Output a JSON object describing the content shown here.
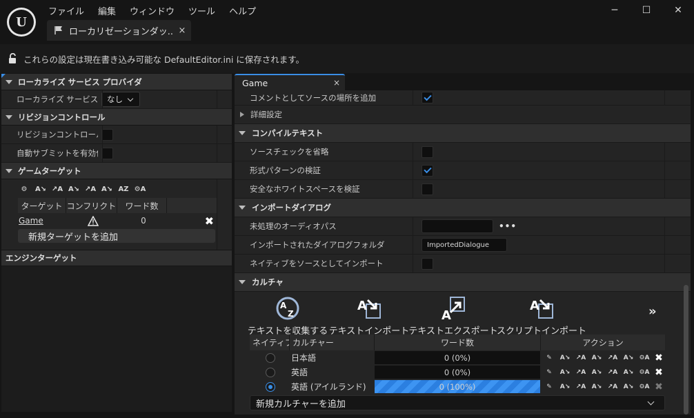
{
  "menu": [
    "ファイル",
    "編集",
    "ウィンドウ",
    "ツール",
    "ヘルプ"
  ],
  "window_controls": {
    "minimize": "─",
    "maximize": "☐",
    "close": "✕"
  },
  "doc_tab": {
    "label": "ローカリゼーションダッ...",
    "close": "×"
  },
  "notice": {
    "text": "これらの設定は現在書き込み可能な DefaultEditor.ini に保存されます。"
  },
  "left": {
    "cat_provider": "ローカライズ サービス プロバイダ",
    "provider_label": "ローカライズ サービス",
    "provider_value": "なし",
    "cat_revision": "リビジョンコントロール",
    "revision_label": "リビジョンコントロール:",
    "autosubmit_label": "自動サブミットを有効化",
    "cat_game_targets": "ゲームターゲット",
    "gt_headers": [
      "ターゲット",
      "コンフリクト",
      "ワード数"
    ],
    "gt_row": {
      "name": "Game",
      "words": "0",
      "delete": "✖"
    },
    "add_target": "新規ターゲットを追加",
    "cat_engine_targets": "エンジンターゲット"
  },
  "right": {
    "tab_label": "Game",
    "tab_close": "×",
    "comment_source": "コメントとしてソースの場所を追加",
    "advanced": "詳細設定",
    "cat_compile": "コンパイルテキスト",
    "skip_source_check": "ソースチェックを省略",
    "validate_format": "形式パターンの検証",
    "validate_whitespace": "安全なホワイトスペースを検証",
    "cat_import_dialogue": "インポートダイアログ",
    "raw_audio_path": "未処理のオーディオパス",
    "raw_audio_dots": "•••",
    "imported_folder_label": "インポートされたダイアログフォルダ",
    "imported_folder_value": "ImportedDialogue",
    "import_native": "ネイティブをソースとしてインポート",
    "cat_culture": "カルチャ",
    "tools": [
      "テキストを収集する",
      "テキストインポート",
      "テキストエクスポート",
      "スクリプトインポート"
    ],
    "more": "»",
    "culture_headers": [
      "ネイティブ",
      "カルチャー",
      "ワード数",
      "アクション"
    ],
    "cultures": [
      {
        "name": "日本語",
        "words": "0 (0%)",
        "progress": 0,
        "native": false
      },
      {
        "name": "英語",
        "words": "0 (0%)",
        "progress": 0,
        "native": false
      },
      {
        "name": "英語 (アイルランド)",
        "words": "0 (100%)",
        "progress": 100,
        "native": true
      }
    ],
    "add_culture": "新規カルチャーを追加"
  },
  "colors": {
    "accent": "#3a8ee6",
    "background": "#151515",
    "panel": "#242424"
  }
}
